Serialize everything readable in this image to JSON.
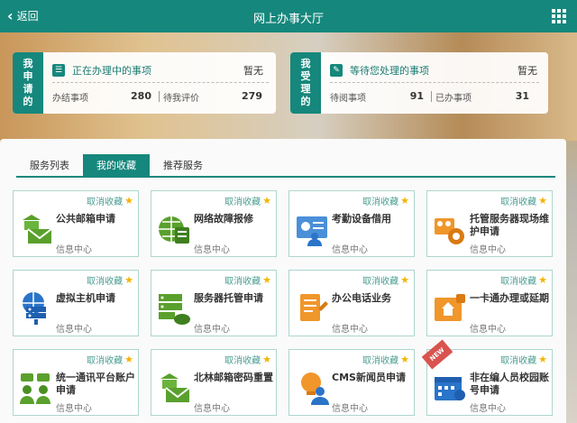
{
  "header": {
    "back_label": "返回",
    "title": "网上办事大厅",
    "back_icon": "chevron-left-icon",
    "menu_icon": "apps-grid-icon"
  },
  "apply": {
    "side": [
      "我",
      "申",
      "请",
      "的"
    ],
    "title": "正在办理中的事项",
    "none": "暂无",
    "done_label": "办结事项",
    "done_value": "280",
    "eval_label": "待我评价",
    "eval_value": "279"
  },
  "accept": {
    "side": [
      "我",
      "受",
      "理",
      "的"
    ],
    "title": "等待您处理的事项",
    "none": "暂无",
    "pending_label": "待阅事项",
    "pending_value": "91",
    "handled_label": "已办事项",
    "handled_value": "31"
  },
  "tabs": [
    "服务列表",
    "我的收藏",
    "推荐服务"
  ],
  "active_tab": "我的收藏",
  "card_cancel": "取消收藏",
  "services": [
    {
      "name": "公共邮箱申请",
      "source": "信息中心",
      "icon": "mail-bank-icon"
    },
    {
      "name": "网络故障报修",
      "source": "信息中心",
      "icon": "globe-repair-icon"
    },
    {
      "name": "考勤设备借用",
      "source": "信息中心",
      "icon": "id-card-icon"
    },
    {
      "name": "托管服务器现场维护申请",
      "source": "信息中心",
      "icon": "gear-maintenance-icon"
    },
    {
      "name": "虚拟主机申请",
      "source": "信息中心",
      "icon": "server-globe-icon"
    },
    {
      "name": "服务器托管申请",
      "source": "信息中心",
      "icon": "server-cloud-icon"
    },
    {
      "name": "办公电话业务",
      "source": "信息中心",
      "icon": "document-pen-icon"
    },
    {
      "name": "一卡通办理或延期",
      "source": "信息中心",
      "icon": "card-house-icon"
    },
    {
      "name": "统一通讯平台账户申请",
      "source": "信息中心",
      "icon": "users-chat-icon"
    },
    {
      "name": "北林邮箱密码重置",
      "source": "信息中心",
      "icon": "mail-reset-icon"
    },
    {
      "name": "CMS新闻员申请",
      "source": "信息中心",
      "icon": "user-bulb-icon"
    },
    {
      "name": "非在编人员校园账号申请",
      "source": "信息中心",
      "icon": "calendar-user-icon",
      "badge": "NEW"
    }
  ],
  "colors": {
    "primary": "#16877c",
    "star": "#f4b400",
    "icon_green": "#5aa02c",
    "icon_blue": "#2a74c9",
    "icon_orange": "#f0962b"
  }
}
